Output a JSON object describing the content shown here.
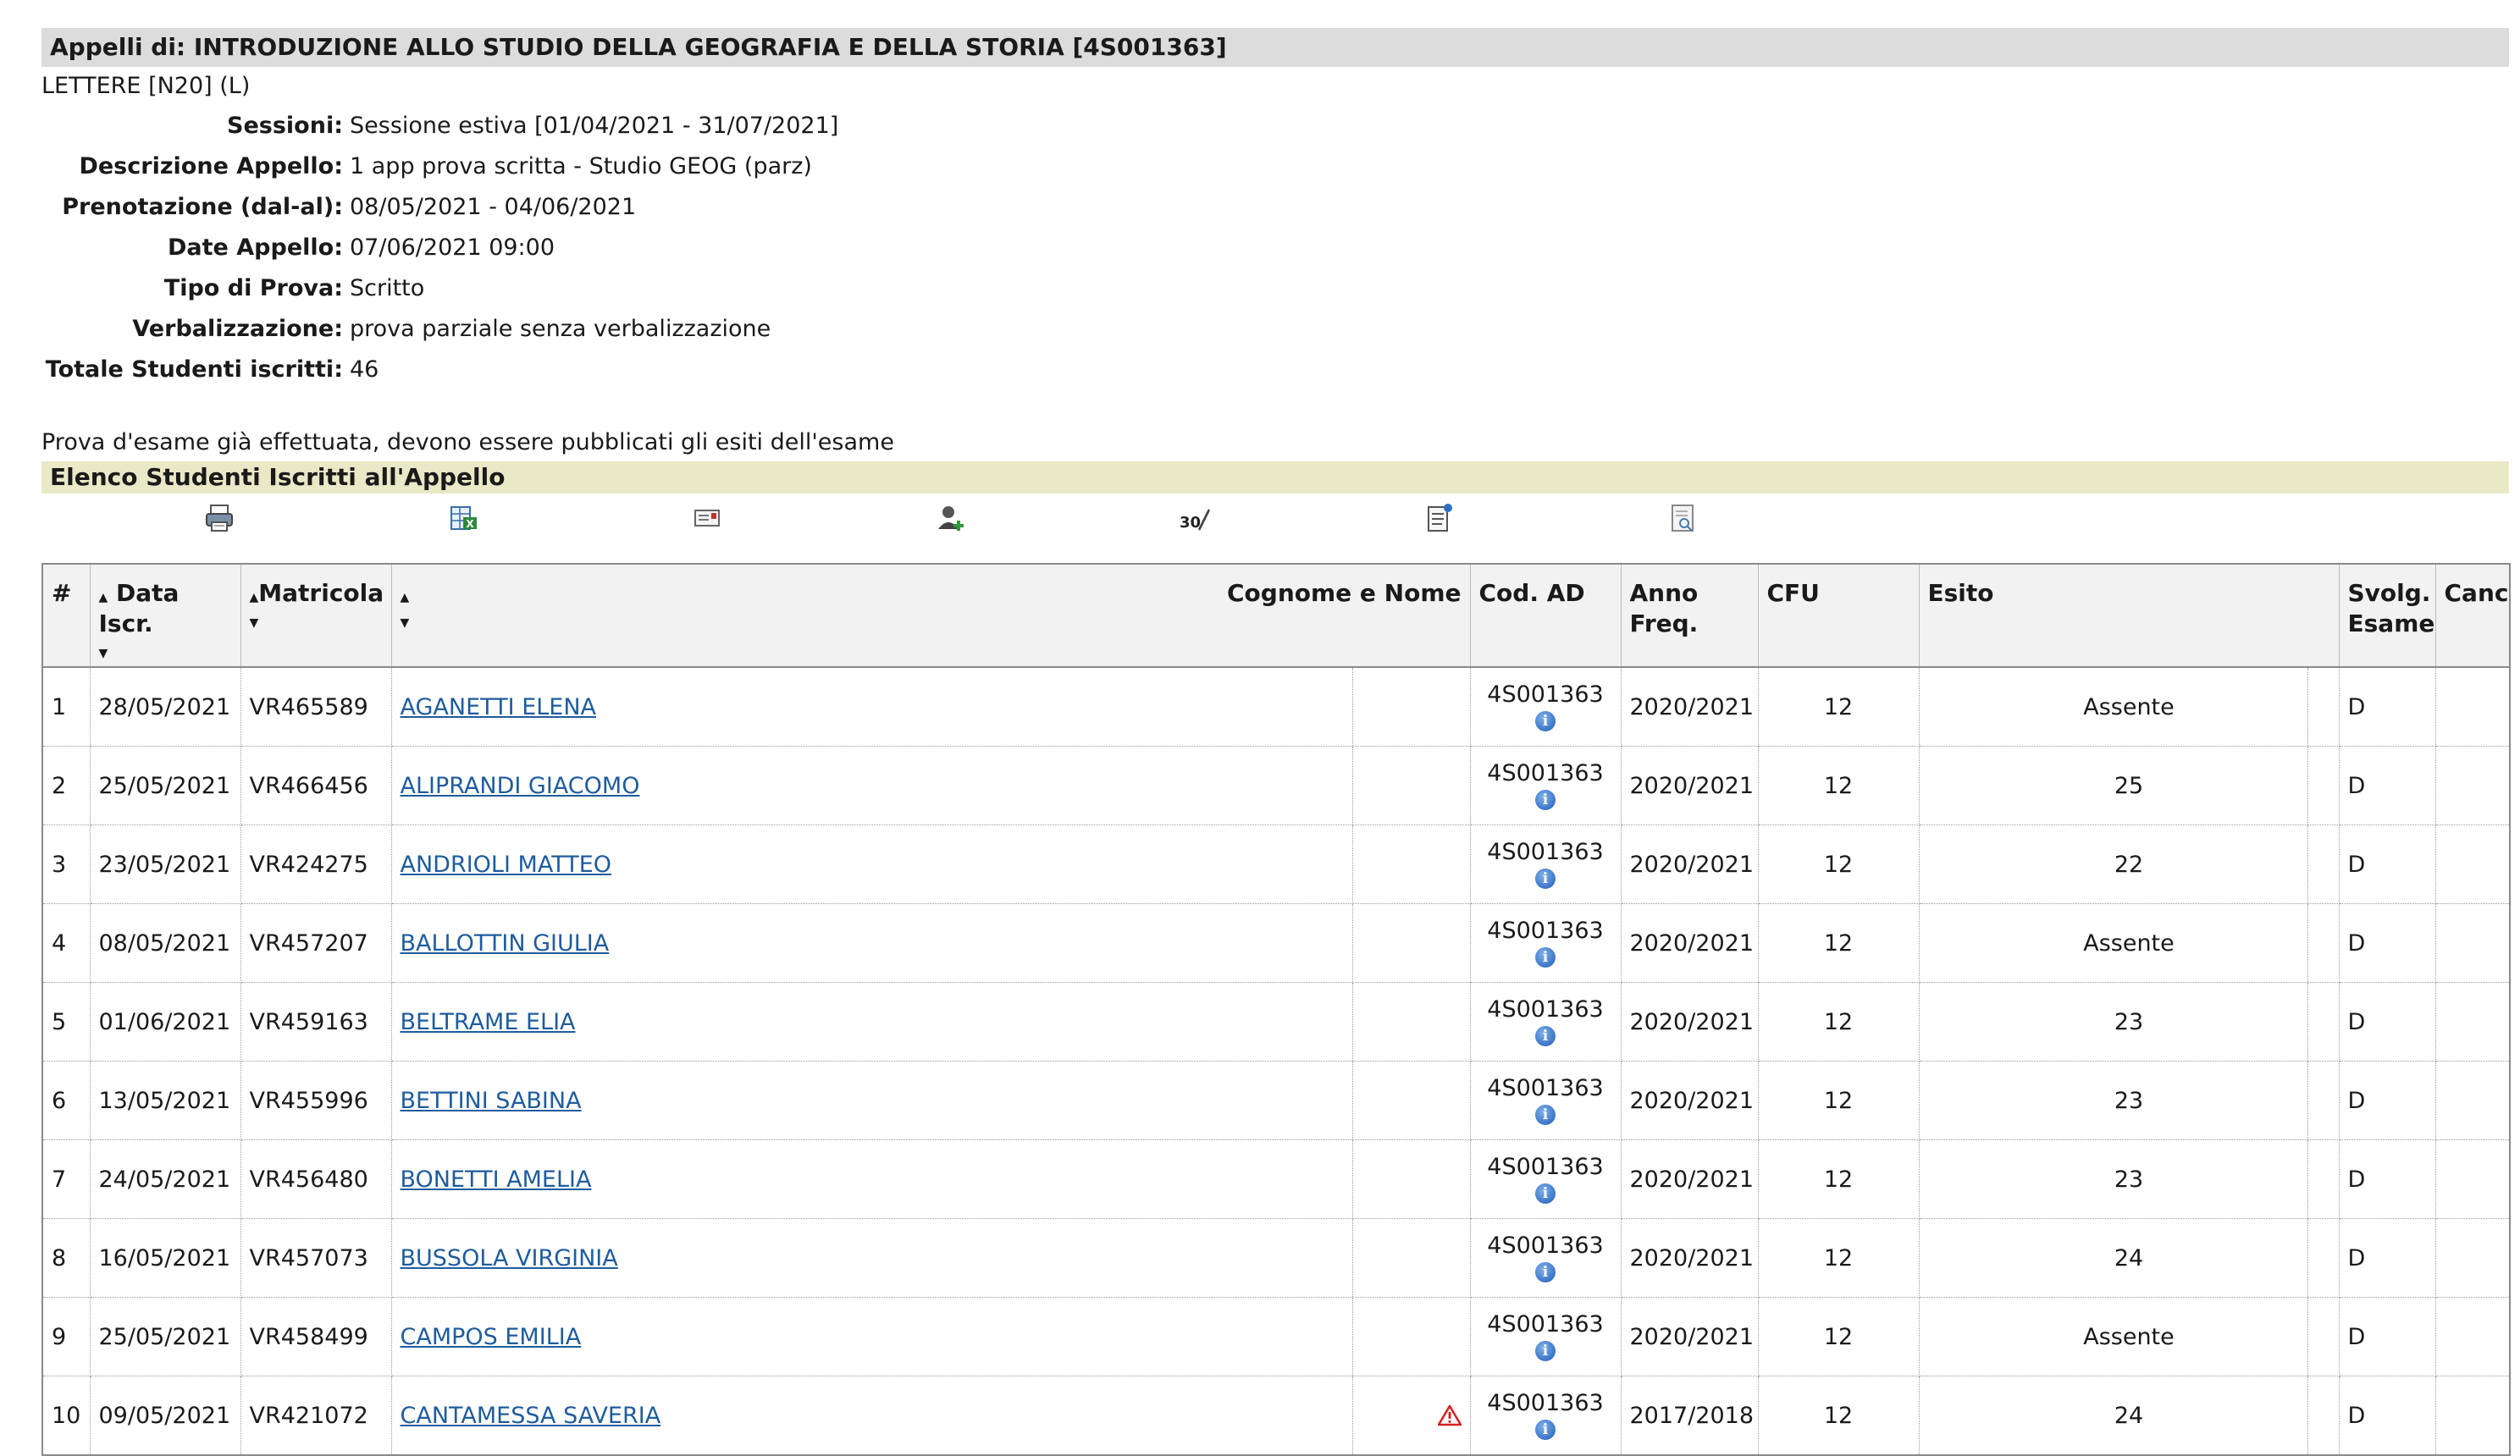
{
  "header": {
    "title": "Appelli di: INTRODUZIONE ALLO STUDIO DELLA GEOGRAFIA E DELLA STORIA [4S001363]",
    "course": "LETTERE [N20] (L)"
  },
  "details": [
    {
      "label": "Sessioni:",
      "value": "Sessione estiva [01/04/2021 - 31/07/2021]"
    },
    {
      "label": "Descrizione Appello:",
      "value": "1 app prova scritta - Studio GEOG (parz)"
    },
    {
      "label": "Prenotazione (dal-al):",
      "value": "08/05/2021 - 04/06/2021"
    },
    {
      "label": "Date Appello:",
      "value": "07/06/2021 09:00"
    },
    {
      "label": "Tipo di Prova:",
      "value": "Scritto"
    },
    {
      "label": "Verbalizzazione:",
      "value": "prova parziale senza verbalizzazione"
    },
    {
      "label": "Totale Studenti iscritti:",
      "value": "46"
    }
  ],
  "note": "Prova d'esame già effettuata, devono essere pubblicati gli esiti dell'esame",
  "section_title": "Elenco Studenti Iscritti all'Appello",
  "toolbar_icons": [
    "print-icon",
    "excel-export-icon",
    "email-icon",
    "add-student-icon",
    "grade-entry-icon",
    "notes-icon",
    "document-preview-icon"
  ],
  "table": {
    "headers": {
      "num": "#",
      "data_iscr": "Data Iscr.",
      "matricola": "Matricola",
      "nome": "Cognome e Nome",
      "cod_ad": "Cod. AD",
      "anno_freq_1": "Anno",
      "anno_freq_2": "Freq.",
      "cfu": "CFU",
      "esito": "Esito",
      "svolg_1": "Svolg.",
      "svolg_2": "Esame",
      "canc": "Canc"
    },
    "rows": [
      {
        "n": "1",
        "data": "28/05/2021",
        "matricola": "VR465589",
        "nome": "AGANETTI ELENA",
        "warn": false,
        "cod": "4S001363",
        "anno": "2020/2021",
        "cfu": "12",
        "esito": "Assente",
        "svolg": "D",
        "canc": ""
      },
      {
        "n": "2",
        "data": "25/05/2021",
        "matricola": "VR466456",
        "nome": "ALIPRANDI GIACOMO",
        "warn": false,
        "cod": "4S001363",
        "anno": "2020/2021",
        "cfu": "12",
        "esito": "25",
        "svolg": "D",
        "canc": ""
      },
      {
        "n": "3",
        "data": "23/05/2021",
        "matricola": "VR424275",
        "nome": "ANDRIOLI MATTEO",
        "warn": false,
        "cod": "4S001363",
        "anno": "2020/2021",
        "cfu": "12",
        "esito": "22",
        "svolg": "D",
        "canc": ""
      },
      {
        "n": "4",
        "data": "08/05/2021",
        "matricola": "VR457207",
        "nome": "BALLOTTIN GIULIA",
        "warn": false,
        "cod": "4S001363",
        "anno": "2020/2021",
        "cfu": "12",
        "esito": "Assente",
        "svolg": "D",
        "canc": ""
      },
      {
        "n": "5",
        "data": "01/06/2021",
        "matricola": "VR459163",
        "nome": "BELTRAME ELIA",
        "warn": false,
        "cod": "4S001363",
        "anno": "2020/2021",
        "cfu": "12",
        "esito": "23",
        "svolg": "D",
        "canc": ""
      },
      {
        "n": "6",
        "data": "13/05/2021",
        "matricola": "VR455996",
        "nome": "BETTINI SABINA",
        "warn": false,
        "cod": "4S001363",
        "anno": "2020/2021",
        "cfu": "12",
        "esito": "23",
        "svolg": "D",
        "canc": ""
      },
      {
        "n": "7",
        "data": "24/05/2021",
        "matricola": "VR456480",
        "nome": "BONETTI AMELIA",
        "warn": false,
        "cod": "4S001363",
        "anno": "2020/2021",
        "cfu": "12",
        "esito": "23",
        "svolg": "D",
        "canc": ""
      },
      {
        "n": "8",
        "data": "16/05/2021",
        "matricola": "VR457073",
        "nome": "BUSSOLA VIRGINIA",
        "warn": false,
        "cod": "4S001363",
        "anno": "2020/2021",
        "cfu": "12",
        "esito": "24",
        "svolg": "D",
        "canc": ""
      },
      {
        "n": "9",
        "data": "25/05/2021",
        "matricola": "VR458499",
        "nome": "CAMPOS EMILIA",
        "warn": false,
        "cod": "4S001363",
        "anno": "2020/2021",
        "cfu": "12",
        "esito": "Assente",
        "svolg": "D",
        "canc": ""
      },
      {
        "n": "10",
        "data": "09/05/2021",
        "matricola": "VR421072",
        "nome": "CANTAMESSA SAVERIA",
        "warn": true,
        "cod": "4S001363",
        "anno": "2017/2018",
        "cfu": "12",
        "esito": "24",
        "svolg": "D",
        "canc": ""
      }
    ]
  },
  "colors": {
    "title_bar": "#dcdcdc",
    "section_bar": "#e9e8c7",
    "link": "#1f5c9e",
    "warning": "#d62020",
    "info": "#1e5bb8"
  }
}
